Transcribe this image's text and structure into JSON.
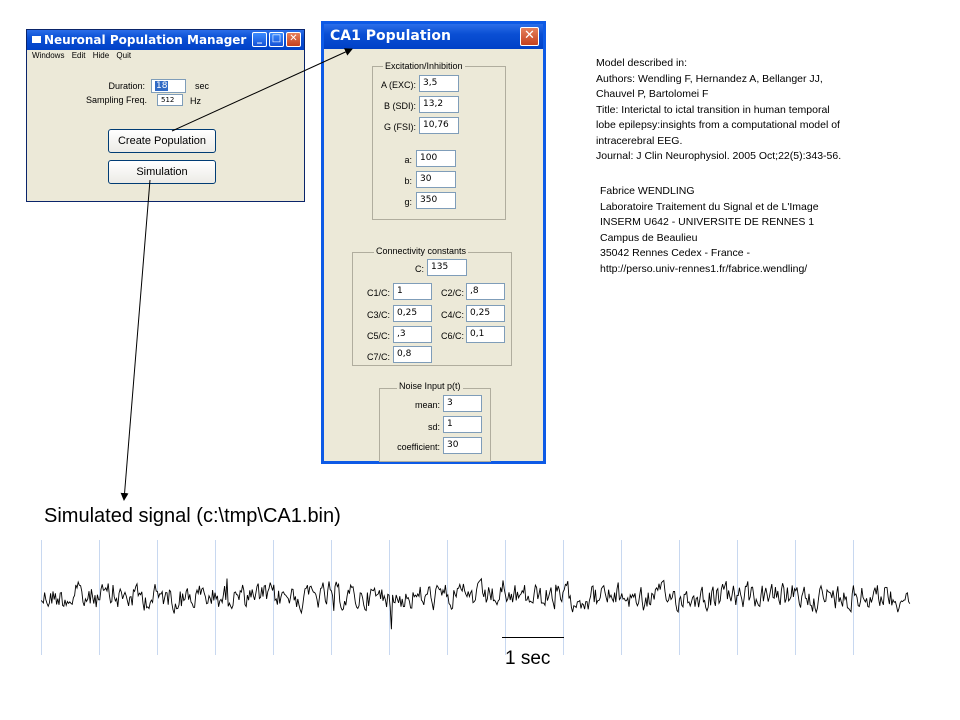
{
  "manager_window": {
    "title": "Neuronal Population Manager",
    "menu": [
      "Windows",
      "Edit",
      "Hide",
      "Quit"
    ],
    "duration_label": "Duration:",
    "duration_value": "18",
    "duration_unit": "sec",
    "sampling_label": "Sampling Freq.",
    "sampling_value": "512",
    "sampling_unit": "Hz",
    "create_button": "Create Population",
    "simulation_button": "Simulation"
  },
  "ca1_window": {
    "title": "CA1 Population",
    "excitation_group": "Excitation/Inhibition",
    "a_exc_label": "A (EXC):",
    "a_exc_value": "3,5",
    "b_sdi_label": "B (SDI):",
    "b_sdi_value": "13,2",
    "g_fsi_label": "G (FSI):",
    "g_fsi_value": "10,76",
    "a_label": "a:",
    "a_value": "100",
    "b_label": "b:",
    "b_value": "30",
    "g_label": "g:",
    "g_value": "350",
    "connectivity_group": "Connectivity constants",
    "c_label": "C:",
    "c_value": "135",
    "c1_label": "C1/C:",
    "c1_value": "1",
    "c2_label": "C2/C:",
    "c2_value": ",8",
    "c3_label": "C3/C:",
    "c3_value": "0,25",
    "c4_label": "C4/C:",
    "c4_value": "0,25",
    "c5_label": "C5/C:",
    "c5_value": ",3",
    "c6_label": "C6/C:",
    "c6_value": "0,1",
    "c7_label": "C7/C:",
    "c7_value": "0,8",
    "noise_group": "Noise Input p(t)",
    "mean_label": "mean:",
    "mean_value": "3",
    "sd_label": "sd:",
    "sd_value": "1",
    "coefficient_label": "coefficient:",
    "coefficient_value": "30"
  },
  "reference": {
    "lines": [
      "Model described in:",
      "Authors: Wendling F, Hernandez A, Bellanger JJ,",
      "Chauvel P, Bartolomei F",
      "Title: Interictal to ictal transition in human temporal",
      "lobe epilepsy:insights from a computational model of",
      "intracerebral EEG.",
      "Journal: J Clin Neurophysiol. 2005 Oct;22(5):343-56."
    ]
  },
  "author": {
    "lines": [
      "Fabrice WENDLING",
      "Laboratoire Traitement du Signal et de L'Image",
      "INSERM U642 - UNIVERSITE DE RENNES 1",
      "Campus de Beaulieu",
      "35042 Rennes Cedex - France -",
      "http://perso.univ-rennes1.fr/fabrice.wendling/"
    ]
  },
  "signal": {
    "caption": "Simulated signal (c:\\tmp\\CA1.bin)",
    "scale_label": "1 sec"
  },
  "colors": {
    "titlebar": "#0a4fd4",
    "window_bg": "#ece9d8",
    "selection": "#316ac5",
    "grid": "#c8d8f0"
  }
}
